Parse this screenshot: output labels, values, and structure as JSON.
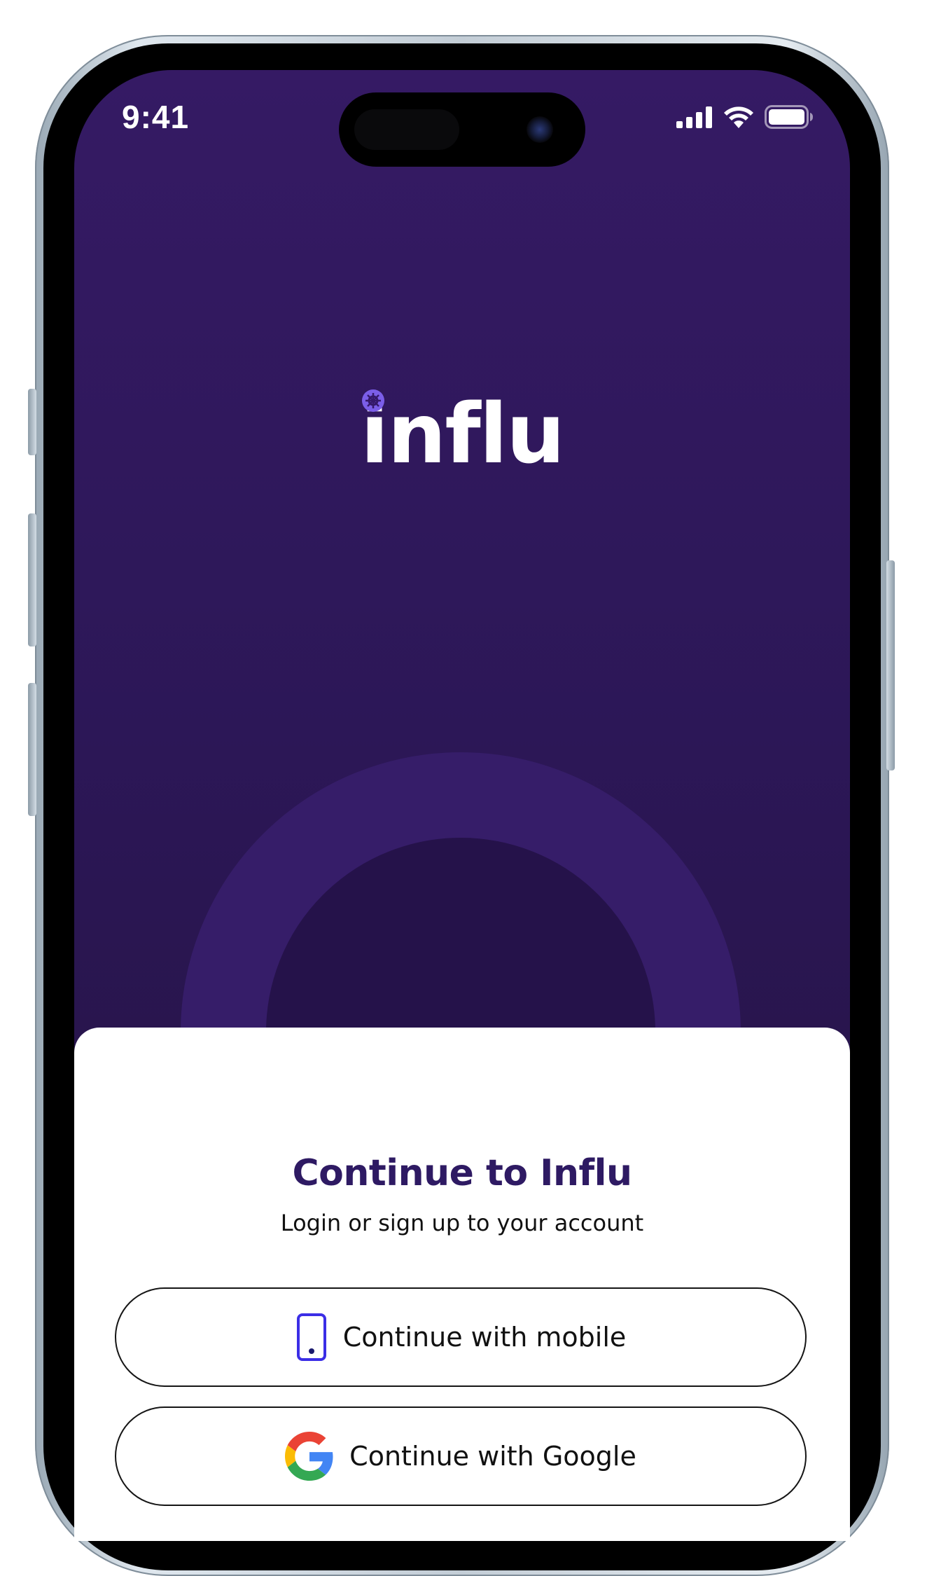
{
  "status_bar": {
    "time": "9:41"
  },
  "icons": {
    "signal": "signal-icon",
    "wifi": "wifi-icon",
    "battery": "battery-icon",
    "phone": "smartphone-icon",
    "google": "google-logo-icon"
  },
  "branding": {
    "logo_text": "influ",
    "accent_color": "#7b5ee8"
  },
  "colors": {
    "background_top": "#351a64",
    "background_bottom": "#23123f",
    "title": "#2e1a63",
    "mobile_icon": "#3b2ee6"
  },
  "auth_sheet": {
    "title": "Continue to Influ",
    "subtitle": "Login or sign up to your account",
    "mobile_button_label": "Continue with mobile",
    "google_button_label": "Continue with Google"
  }
}
